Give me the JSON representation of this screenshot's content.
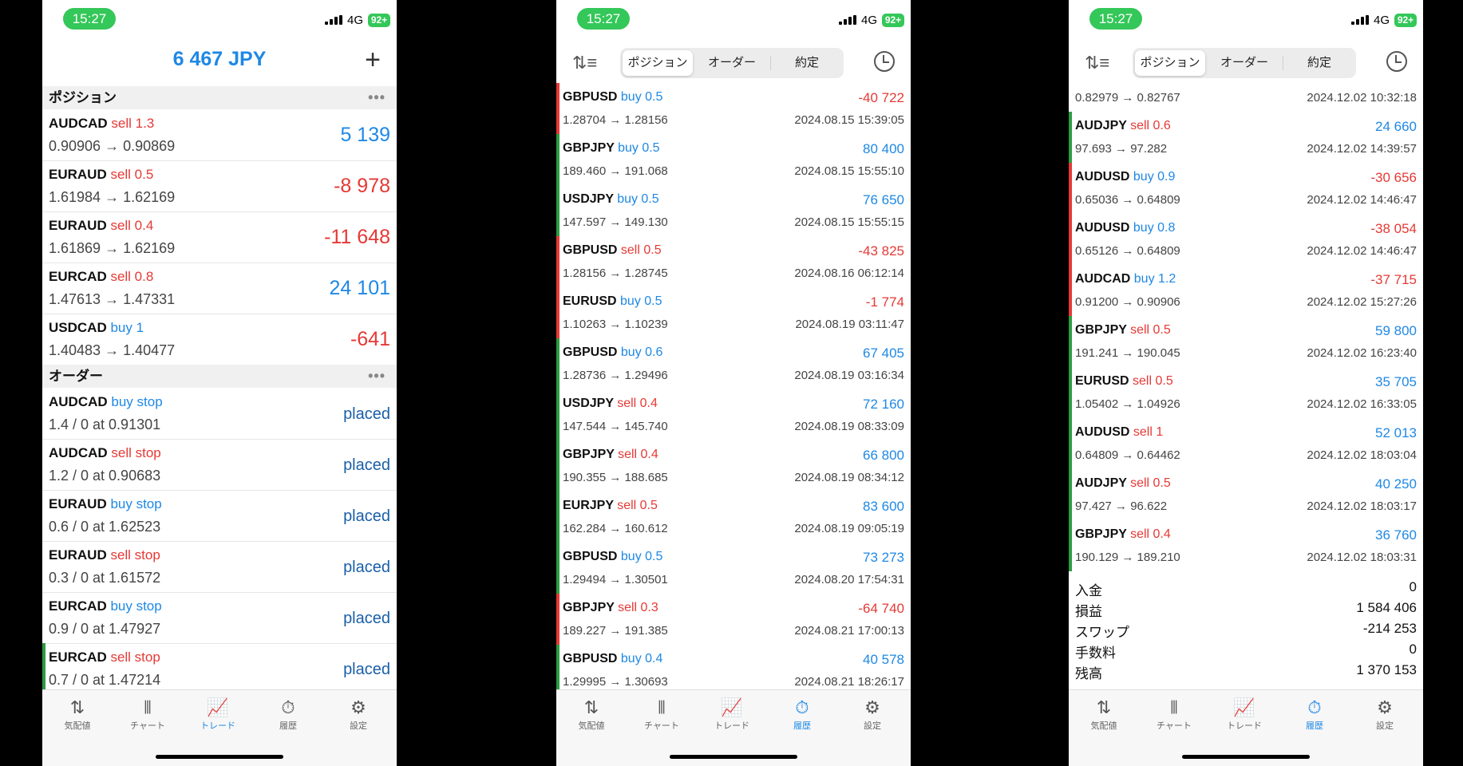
{
  "status": {
    "time": "15:27",
    "network": "4G",
    "battery": "92+"
  },
  "tabs": [
    "気配値",
    "チャート",
    "トレード",
    "履歴",
    "設定"
  ],
  "history_tabs": [
    "ポジション",
    "オーダー",
    "約定"
  ],
  "trade": {
    "balance": "6 467 JPY",
    "positions_label": "ポジション",
    "orders_label": "オーダー",
    "positions": [
      {
        "symbol": "AUDCAD",
        "side": "sell 1.3",
        "type": "sell",
        "prices": "0.90906 → 0.90869",
        "value": "5 139",
        "positive": true
      },
      {
        "symbol": "EURAUD",
        "side": "sell 0.5",
        "type": "sell",
        "prices": "1.61984 → 1.62169",
        "value": "-8 978",
        "positive": false
      },
      {
        "symbol": "EURAUD",
        "side": "sell 0.4",
        "type": "sell",
        "prices": "1.61869 → 1.62169",
        "value": "-11 648",
        "positive": false
      },
      {
        "symbol": "EURCAD",
        "side": "sell 0.8",
        "type": "sell",
        "prices": "1.47613 → 1.47331",
        "value": "24 101",
        "positive": true
      },
      {
        "symbol": "USDCAD",
        "side": "buy 1",
        "type": "buy",
        "prices": "1.40483 → 1.40477",
        "value": "-641",
        "positive": false
      }
    ],
    "orders": [
      {
        "symbol": "AUDCAD",
        "side": "buy stop",
        "type": "buy",
        "detail": "1.4 / 0 at 0.91301",
        "status": "placed"
      },
      {
        "symbol": "AUDCAD",
        "side": "sell stop",
        "type": "sell",
        "detail": "1.2 / 0 at 0.90683",
        "status": "placed"
      },
      {
        "symbol": "EURAUD",
        "side": "buy stop",
        "type": "buy",
        "detail": "0.6 / 0 at 1.62523",
        "status": "placed"
      },
      {
        "symbol": "EURAUD",
        "side": "sell stop",
        "type": "sell",
        "detail": "0.3 / 0 at 1.61572",
        "status": "placed"
      },
      {
        "symbol": "EURCAD",
        "side": "buy stop",
        "type": "buy",
        "detail": "0.9 / 0 at 1.47927",
        "status": "placed"
      },
      {
        "symbol": "EURCAD",
        "side": "sell stop",
        "type": "sell",
        "detail": "0.7 / 0 at 1.47214",
        "status": "placed"
      }
    ]
  },
  "history1": [
    {
      "symbol": "GBPUSD",
      "side": "buy 0.5",
      "type": "buy",
      "prices": "1.28704 → 1.28156",
      "value": "-40 722",
      "positive": false,
      "date": "2024.08.15 15:39:05"
    },
    {
      "symbol": "GBPJPY",
      "side": "buy 0.5",
      "type": "buy",
      "prices": "189.460 → 191.068",
      "value": "80 400",
      "positive": true,
      "date": "2024.08.15 15:55:10"
    },
    {
      "symbol": "USDJPY",
      "side": "buy 0.5",
      "type": "buy",
      "prices": "147.597 → 149.130",
      "value": "76 650",
      "positive": true,
      "date": "2024.08.15 15:55:15"
    },
    {
      "symbol": "GBPUSD",
      "side": "sell 0.5",
      "type": "sell",
      "prices": "1.28156 → 1.28745",
      "value": "-43 825",
      "positive": false,
      "date": "2024.08.16 06:12:14"
    },
    {
      "symbol": "EURUSD",
      "side": "buy 0.5",
      "type": "buy",
      "prices": "1.10263 → 1.10239",
      "value": "-1 774",
      "positive": false,
      "date": "2024.08.19 03:11:47"
    },
    {
      "symbol": "GBPUSD",
      "side": "buy 0.6",
      "type": "buy",
      "prices": "1.28736 → 1.29496",
      "value": "67 405",
      "positive": true,
      "date": "2024.08.19 03:16:34"
    },
    {
      "symbol": "USDJPY",
      "side": "sell 0.4",
      "type": "sell",
      "prices": "147.544 → 145.740",
      "value": "72 160",
      "positive": true,
      "date": "2024.08.19 08:33:09"
    },
    {
      "symbol": "GBPJPY",
      "side": "sell 0.4",
      "type": "sell",
      "prices": "190.355 → 188.685",
      "value": "66 800",
      "positive": true,
      "date": "2024.08.19 08:34:12"
    },
    {
      "symbol": "EURJPY",
      "side": "sell 0.5",
      "type": "sell",
      "prices": "162.284 → 160.612",
      "value": "83 600",
      "positive": true,
      "date": "2024.08.19 09:05:19"
    },
    {
      "symbol": "GBPUSD",
      "side": "buy 0.5",
      "type": "buy",
      "prices": "1.29494 → 1.30501",
      "value": "73 273",
      "positive": true,
      "date": "2024.08.20 17:54:31"
    },
    {
      "symbol": "GBPJPY",
      "side": "sell 0.3",
      "type": "sell",
      "prices": "189.227 → 191.385",
      "value": "-64 740",
      "positive": false,
      "date": "2024.08.21 17:00:13"
    },
    {
      "symbol": "GBPUSD",
      "side": "buy 0.4",
      "type": "buy",
      "prices": "1.29995 → 1.30693",
      "value": "40 578",
      "positive": true,
      "date": "2024.08.21 18:26:17"
    }
  ],
  "history2_top": {
    "prices": "0.82979 → 0.82767",
    "date": "2024.12.02 10:32:18"
  },
  "history2": [
    {
      "symbol": "AUDJPY",
      "side": "sell 0.6",
      "type": "sell",
      "prices": "97.693 → 97.282",
      "value": "24 660",
      "positive": true,
      "date": "2024.12.02 14:39:57"
    },
    {
      "symbol": "AUDUSD",
      "side": "buy 0.9",
      "type": "buy",
      "prices": "0.65036 → 0.64809",
      "value": "-30 656",
      "positive": false,
      "date": "2024.12.02 14:46:47"
    },
    {
      "symbol": "AUDUSD",
      "side": "buy 0.8",
      "type": "buy",
      "prices": "0.65126 → 0.64809",
      "value": "-38 054",
      "positive": false,
      "date": "2024.12.02 14:46:47"
    },
    {
      "symbol": "AUDCAD",
      "side": "buy 1.2",
      "type": "buy",
      "prices": "0.91200 → 0.90906",
      "value": "-37 715",
      "positive": false,
      "date": "2024.12.02 15:27:26"
    },
    {
      "symbol": "GBPJPY",
      "side": "sell 0.5",
      "type": "sell",
      "prices": "191.241 → 190.045",
      "value": "59 800",
      "positive": true,
      "date": "2024.12.02 16:23:40"
    },
    {
      "symbol": "EURUSD",
      "side": "sell 0.5",
      "type": "sell",
      "prices": "1.05402 → 1.04926",
      "value": "35 705",
      "positive": true,
      "date": "2024.12.02 16:33:05"
    },
    {
      "symbol": "AUDUSD",
      "side": "sell 1",
      "type": "sell",
      "prices": "0.64809 → 0.64462",
      "value": "52 013",
      "positive": true,
      "date": "2024.12.02 18:03:04"
    },
    {
      "symbol": "AUDJPY",
      "side": "sell 0.5",
      "type": "sell",
      "prices": "97.427 → 96.622",
      "value": "40 250",
      "positive": true,
      "date": "2024.12.02 18:03:17"
    },
    {
      "symbol": "GBPJPY",
      "side": "sell 0.4",
      "type": "sell",
      "prices": "190.129 → 189.210",
      "value": "36 760",
      "positive": true,
      "date": "2024.12.02 18:03:31"
    }
  ],
  "summary": [
    {
      "label": "入金",
      "value": "0"
    },
    {
      "label": "損益",
      "value": "1 584 406"
    },
    {
      "label": "スワップ",
      "value": "-214 253"
    },
    {
      "label": "手数料",
      "value": "0"
    },
    {
      "label": "残高",
      "value": "1 370 153"
    }
  ],
  "colors": {
    "blue": "#1e88e5",
    "red": "#e53935",
    "green": "#2e9c42"
  }
}
